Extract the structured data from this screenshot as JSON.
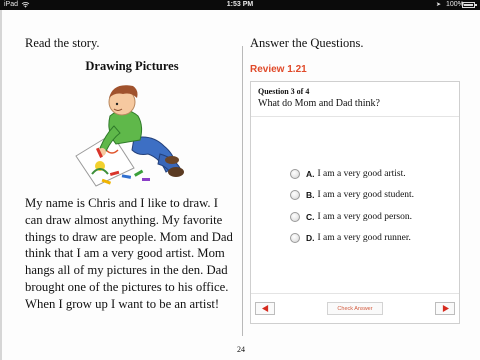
{
  "status_bar": {
    "carrier": "iPad",
    "time": "1:53 PM",
    "battery_text": "100%",
    "battery_level": 1.0,
    "icons": [
      "wifi-icon",
      "location-arrow-icon",
      "battery-icon"
    ]
  },
  "left": {
    "heading": "Read the story.",
    "story_title": "Drawing Pictures",
    "illustration": "boy-drawing-picture",
    "story_text": "My name is Chris and I like to draw. I can draw almost anything. My favorite things to draw are people. Mom and Dad think that I am a very good artist. Mom hangs all of my pictures in the den. Dad brought one of the pictures to his office. When I grow up I want to be an artist!"
  },
  "right": {
    "heading": "Answer the Questions.",
    "review_label": "Review 1.21",
    "question_number": "Question 3 of 4",
    "question_text": "What do Mom and Dad think?",
    "options": [
      {
        "letter": "A.",
        "text": "I am a very good artist."
      },
      {
        "letter": "B.",
        "text": "I am a very good student."
      },
      {
        "letter": "C.",
        "text": "I am a very good person."
      },
      {
        "letter": "D.",
        "text": "I am a very good runner."
      }
    ],
    "check_answer_label": "Check Answer",
    "prev_icon": "left-triangle-icon",
    "next_icon": "right-triangle-icon"
  },
  "page_number": "24",
  "colors": {
    "accent": "#e04a2a",
    "nav_arrow": "#d62a1e",
    "divider": "#b9b9b9"
  }
}
